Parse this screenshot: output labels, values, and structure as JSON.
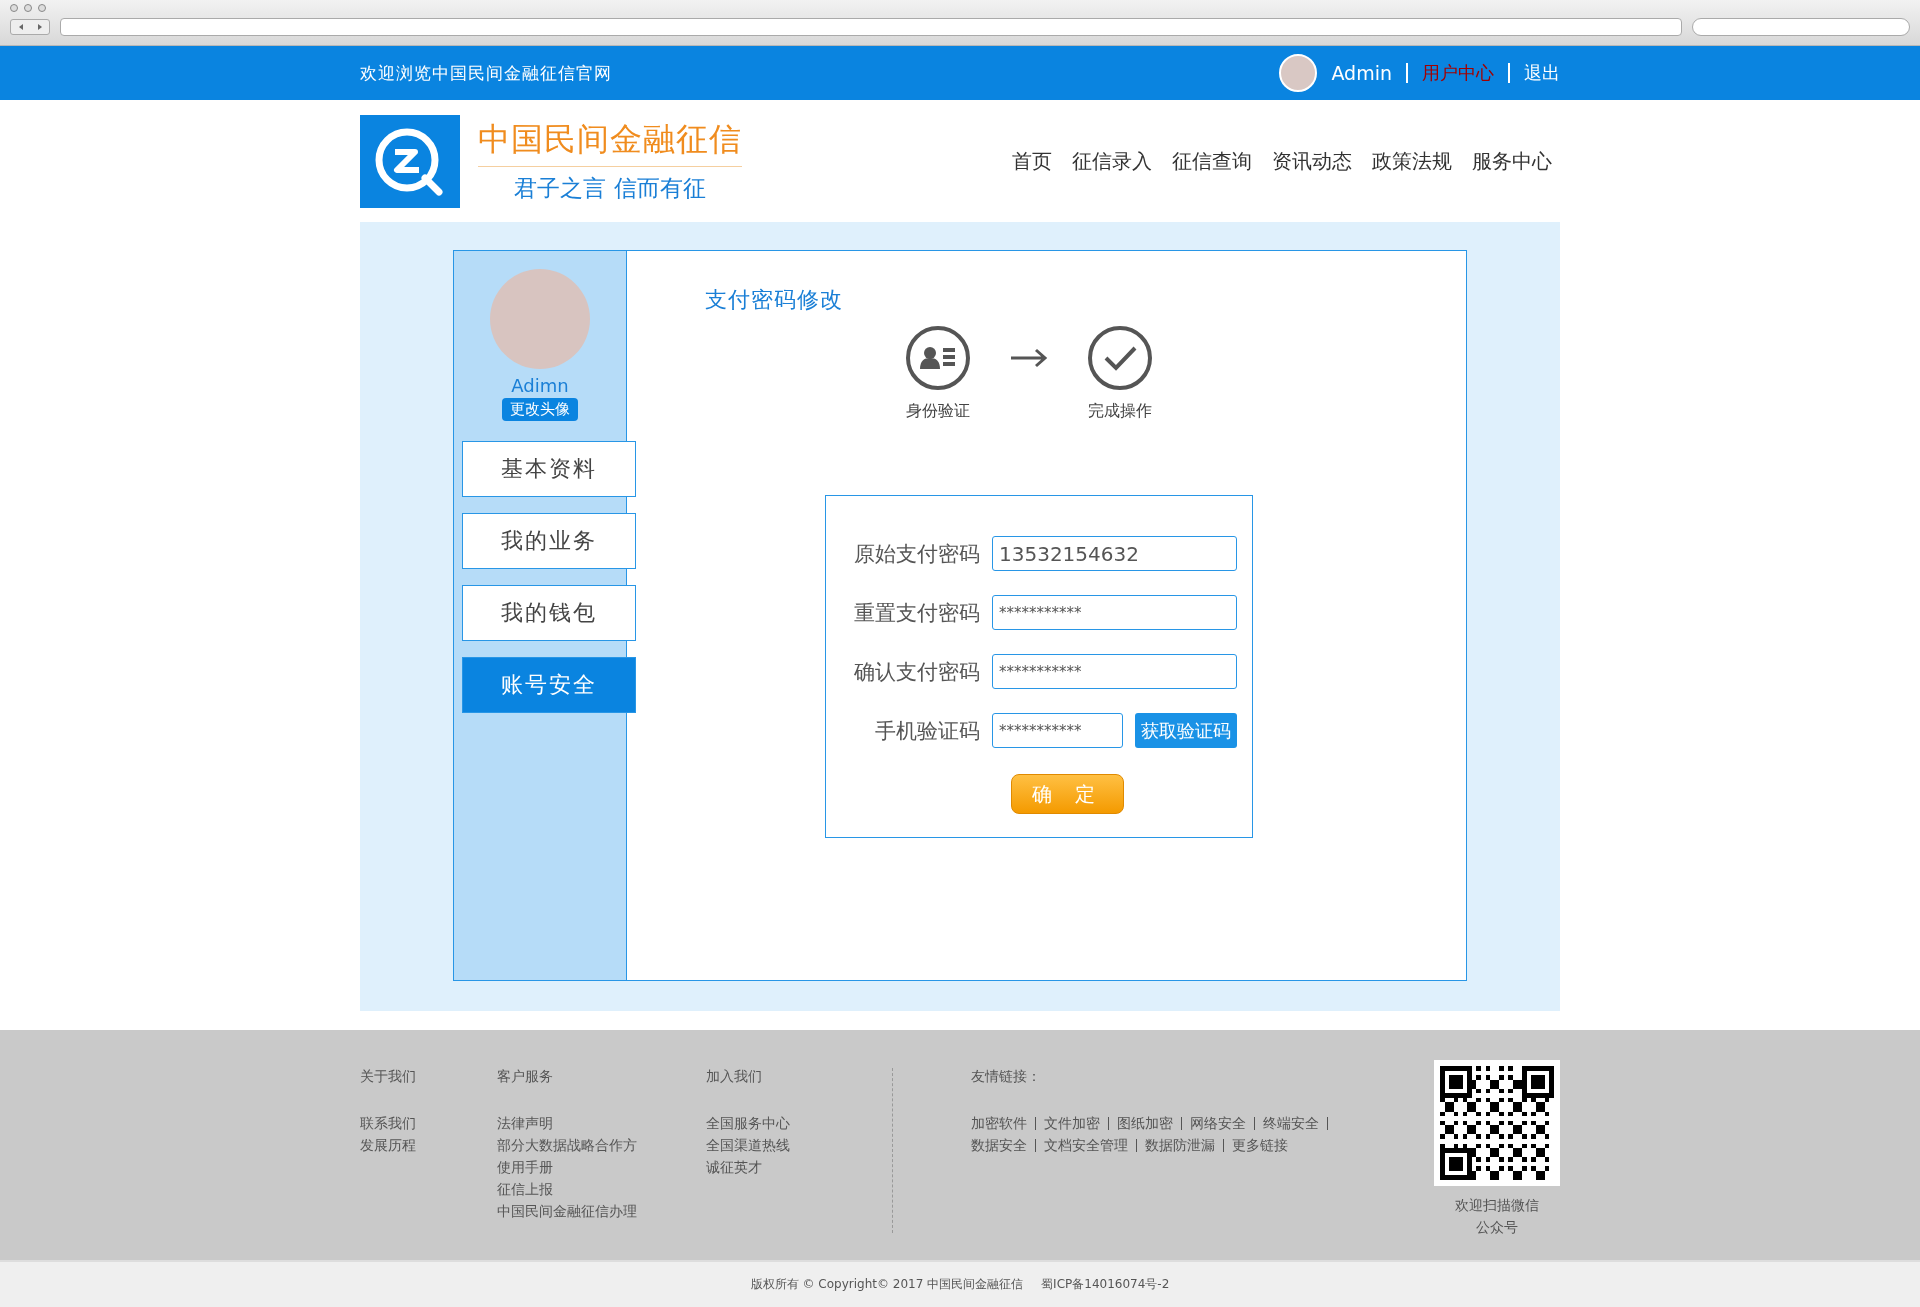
{
  "topbar": {
    "welcome": "欢迎浏览中国民间金融征信官网",
    "user": "Admin",
    "links": [
      {
        "label": "用户中心",
        "selected": true
      },
      {
        "label": "退出",
        "selected": false
      }
    ]
  },
  "brand": {
    "name": "中国民间金融征信",
    "slogan": "君子之言 信而有征"
  },
  "nav": [
    "首页",
    "征信录入",
    "征信查询",
    "资讯动态",
    "政策法规",
    "服务中心"
  ],
  "sidebar": {
    "user": "Adimn",
    "change_avatar": "更改头像",
    "items": [
      {
        "label": "基本资料",
        "selected": false
      },
      {
        "label": "我的业务",
        "selected": false
      },
      {
        "label": "我的钱包",
        "selected": false
      },
      {
        "label": "账号安全",
        "selected": true
      }
    ]
  },
  "page_title": "支付密码修改",
  "steps": [
    {
      "kind": "identity",
      "label": "身份验证"
    },
    {
      "kind": "done",
      "label": "完成操作"
    }
  ],
  "form": {
    "fields": [
      {
        "kind": "plain",
        "label": "原始支付密码",
        "value": "13532154632"
      },
      {
        "kind": "plain",
        "label": "重置支付密码",
        "value": "***********"
      },
      {
        "kind": "plain",
        "label": "确认支付密码",
        "value": "***********"
      },
      {
        "kind": "with-button",
        "label": "手机验证码",
        "value": "***********",
        "button": "获取验证码"
      }
    ],
    "submit": "确 定"
  },
  "footer": {
    "columns": [
      {
        "title": "关于我们",
        "links": [
          "联系我们",
          "发展历程"
        ]
      },
      {
        "title": "客户服务",
        "links": [
          "法律声明",
          "部分大数据战略合作方",
          "使用手册",
          "征信上报",
          "中国民间金融征信办理"
        ]
      },
      {
        "title": "加入我们",
        "links": [
          "全国服务中心",
          "全国渠道热线",
          "诚征英才"
        ]
      }
    ],
    "friends": {
      "title": "友情链接：",
      "rows": [
        [
          "加密软件",
          "文件加密",
          "图纸加密",
          "网络安全",
          "终端安全"
        ],
        [
          "数据安全",
          "文档安全管理",
          "数据防泄漏",
          "更多链接"
        ]
      ]
    },
    "qr_caption": "欢迎扫描微信公众号"
  },
  "copyright": "版权所有 © Copyright© 2017 中国民间金融征信",
  "icp": "蜀ICP备14016074号-2"
}
